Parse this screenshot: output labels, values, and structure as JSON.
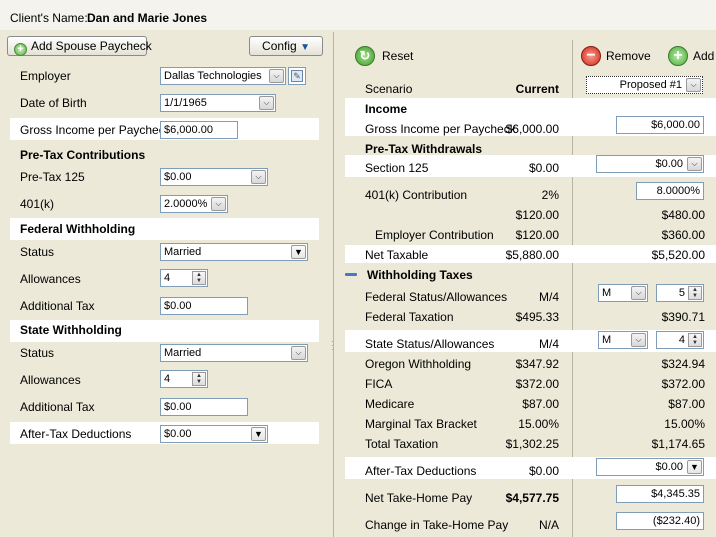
{
  "header": {
    "client_label": "Client's Name:",
    "client_name": "Dan and Marie Jones"
  },
  "left": {
    "add_spouse_label": "Add Spouse Paycheck",
    "config_label": "Config",
    "employer_label": "Employer",
    "employer_value": "Dallas Technologies",
    "dob_label": "Date of Birth",
    "dob_value": "1/1/1965",
    "gross_label": "Gross Income per Paycheck",
    "gross_value": "$6,000.00",
    "pretax_header": "Pre-Tax Contributions",
    "pretax125_label": "Pre-Tax 125",
    "pretax125_value": "$0.00",
    "k401_label": "401(k)",
    "k401_value": "2.0000%",
    "federal_header": "Federal Withholding",
    "fed_status_label": "Status",
    "fed_status_value": "Married",
    "fed_allow_label": "Allowances",
    "fed_allow_value": "4",
    "fed_addtax_label": "Additional Tax",
    "fed_addtax_value": "$0.00",
    "state_header": "State Withholding",
    "st_status_label": "Status",
    "st_status_value": "Married",
    "st_allow_label": "Allowances",
    "st_allow_value": "4",
    "st_addtax_label": "Additional Tax",
    "st_addtax_value": "$0.00",
    "aftertax_label": "After-Tax Deductions",
    "aftertax_value": "$0.00"
  },
  "right": {
    "reset_label": "Reset",
    "remove_label": "Remove",
    "add_label": "Add",
    "scenario_label": "Scenario",
    "current_label": "Current",
    "proposed_value": "Proposed #1",
    "income_header": "Income",
    "gross_label": "Gross Income per Paycheck",
    "gross_current": "$6,000.00",
    "gross_proposed": "$6,000.00",
    "pretax_header": "Pre-Tax Withdrawals",
    "s125_label": "Section 125",
    "s125_current": "$0.00",
    "s125_proposed": "$0.00",
    "k401_label": "401(k) Contribution",
    "k401_current": "2%",
    "k401_proposed": "8.0000%",
    "k401_amt_current": "$120.00",
    "k401_amt_proposed": "$480.00",
    "employer_contrib_label": "Employer Contribution",
    "employer_contrib_current": "$120.00",
    "employer_contrib_proposed": "$360.00",
    "net_taxable_label": "Net Taxable",
    "net_taxable_current": "$5,880.00",
    "net_taxable_proposed": "$5,520.00",
    "withholding_header": "Withholding Taxes",
    "fed_sa_label": "Federal Status/Allowances",
    "fed_sa_current": "M/4",
    "fed_status_proposed": "M",
    "fed_allow_proposed": "5",
    "fed_tax_label": "Federal Taxation",
    "fed_tax_current": "$495.33",
    "fed_tax_proposed": "$390.71",
    "st_sa_label": "State Status/Allowances",
    "st_sa_current": "M/4",
    "st_status_proposed": "M",
    "st_allow_proposed": "4",
    "oregon_label": "Oregon Withholding",
    "oregon_current": "$347.92",
    "oregon_proposed": "$324.94",
    "fica_label": "FICA",
    "fica_current": "$372.00",
    "fica_proposed": "$372.00",
    "medicare_label": "Medicare",
    "medicare_current": "$87.00",
    "medicare_proposed": "$87.00",
    "bracket_label": "Marginal Tax Bracket",
    "bracket_current": "15.00%",
    "bracket_proposed": "15.00%",
    "total_tax_label": "Total Taxation",
    "total_tax_current": "$1,302.25",
    "total_tax_proposed": "$1,174.65",
    "aftertax_label": "After-Tax Deductions",
    "aftertax_current": "$0.00",
    "aftertax_proposed": "$0.00",
    "net_home_label": "Net Take-Home Pay",
    "net_home_current": "$4,577.75",
    "net_home_proposed": "$4,345.35",
    "change_label": "Change in Take-Home Pay",
    "change_current": "N/A",
    "change_proposed": "($232.40)"
  }
}
